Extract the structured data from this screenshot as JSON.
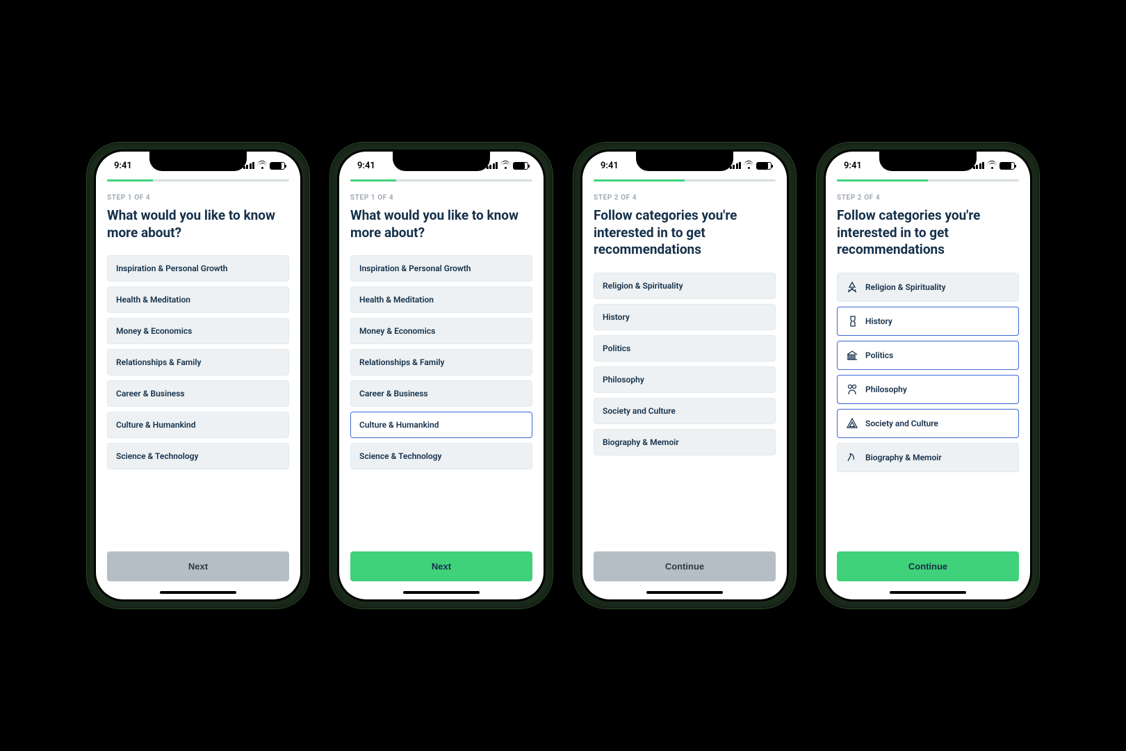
{
  "status_time": "9:41",
  "screens": [
    {
      "step_label": "STEP 1 OF 4",
      "progress_percent": 25,
      "headline": "What would you like to know more about?",
      "show_icons": false,
      "options": [
        {
          "label": "Inspiration & Personal Growth",
          "selected": false
        },
        {
          "label": "Health & Meditation",
          "selected": false
        },
        {
          "label": "Money & Economics",
          "selected": false
        },
        {
          "label": "Relationships & Family",
          "selected": false
        },
        {
          "label": "Career & Business",
          "selected": false
        },
        {
          "label": "Culture & Humankind",
          "selected": false
        },
        {
          "label": "Science & Technology",
          "selected": false
        }
      ],
      "cta_label": "Next",
      "cta_enabled": false
    },
    {
      "step_label": "STEP 1 OF 4",
      "progress_percent": 25,
      "headline": "What would you like to know more about?",
      "show_icons": false,
      "options": [
        {
          "label": "Inspiration & Personal Growth",
          "selected": false
        },
        {
          "label": "Health & Meditation",
          "selected": false
        },
        {
          "label": "Money & Economics",
          "selected": false
        },
        {
          "label": "Relationships & Family",
          "selected": false
        },
        {
          "label": "Career & Business",
          "selected": false
        },
        {
          "label": "Culture & Humankind",
          "selected": true
        },
        {
          "label": "Science & Technology",
          "selected": false
        }
      ],
      "cta_label": "Next",
      "cta_enabled": true
    },
    {
      "step_label": "STEP 2 OF 4",
      "progress_percent": 50,
      "headline": "Follow categories you're interested in to get recommendations",
      "show_icons": false,
      "options": [
        {
          "label": "Religion & Spirituality",
          "selected": false
        },
        {
          "label": "History",
          "selected": false
        },
        {
          "label": "Politics",
          "selected": false
        },
        {
          "label": "Philosophy",
          "selected": false
        },
        {
          "label": "Society and Culture",
          "selected": false
        },
        {
          "label": "Biography & Memoir",
          "selected": false
        }
      ],
      "cta_label": "Continue",
      "cta_enabled": false
    },
    {
      "step_label": "STEP 2 OF 4",
      "progress_percent": 50,
      "headline": "Follow categories you're interested in to get recommendations",
      "show_icons": true,
      "options": [
        {
          "label": "Religion & Spirituality",
          "selected": false,
          "icon": "spirituality"
        },
        {
          "label": "History",
          "selected": true,
          "icon": "history"
        },
        {
          "label": "Politics",
          "selected": true,
          "icon": "politics"
        },
        {
          "label": "Philosophy",
          "selected": true,
          "icon": "philosophy"
        },
        {
          "label": "Society and Culture",
          "selected": true,
          "icon": "society"
        },
        {
          "label": "Biography & Memoir",
          "selected": false,
          "icon": "biography"
        }
      ],
      "cta_label": "Continue",
      "cta_enabled": true
    }
  ]
}
